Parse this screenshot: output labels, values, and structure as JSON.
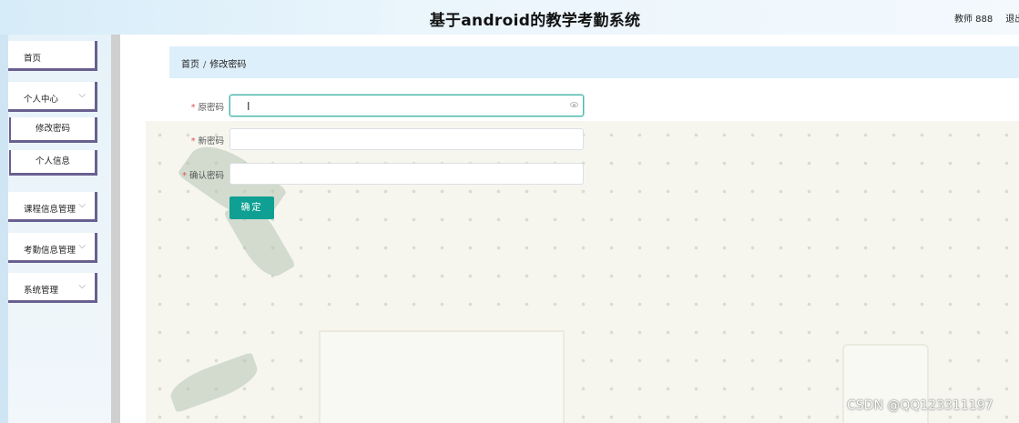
{
  "header": {
    "title": "基于android的教学考勤系统",
    "user": "教师 888",
    "logout": "退出"
  },
  "sidebar": {
    "items": [
      {
        "label": "首页"
      },
      {
        "label": "个人中心",
        "expanded": true,
        "children": [
          {
            "label": "修改密码"
          },
          {
            "label": "个人信息"
          }
        ]
      },
      {
        "label": "课程信息管理"
      },
      {
        "label": "考勤信息管理"
      },
      {
        "label": "系统管理"
      }
    ]
  },
  "breadcrumb": {
    "home": "首页",
    "separator": "/",
    "current": "修改密码"
  },
  "form": {
    "required_mark": "*",
    "old_password_label": "原密码",
    "new_password_label": "新密码",
    "confirm_password_label": "确认密码",
    "old_password_value": "",
    "new_password_value": "",
    "confirm_password_value": "",
    "submit_label": "确定"
  },
  "icons": {
    "menu_chevron": "chevron-down-icon",
    "password_toggle": "eye-icon"
  },
  "colors": {
    "accent": "#0fa093",
    "header_bg": "#d6ecf8",
    "breadcrumb_bg": "#ddeffa",
    "sidebar_border": "#6a6090",
    "required": "#e05050"
  },
  "watermark": "CSDN @QQ123311197"
}
